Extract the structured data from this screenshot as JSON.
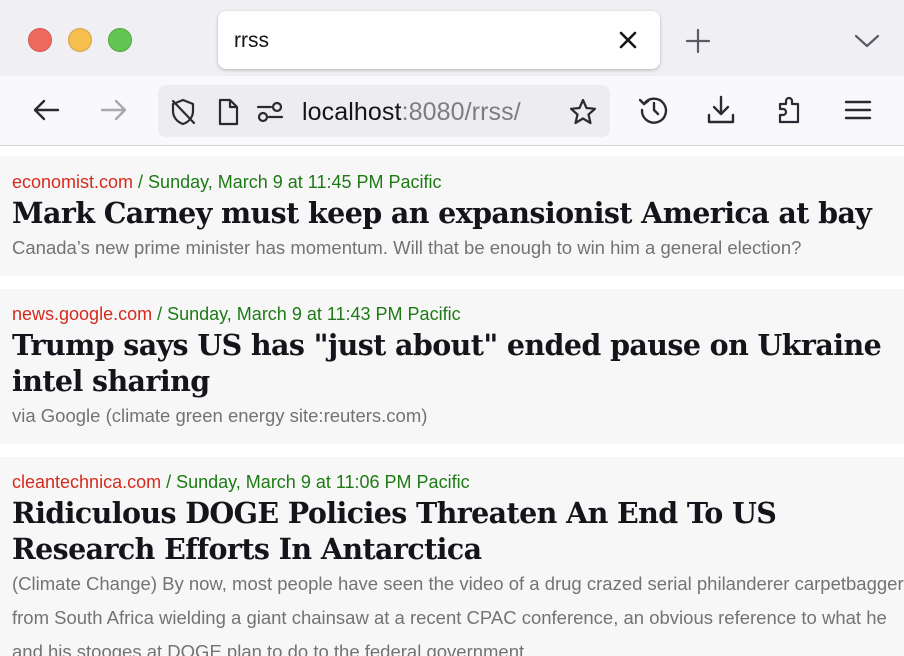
{
  "browser": {
    "tab": {
      "title": "rrss"
    },
    "url": {
      "host": "localhost",
      "rest": ":8080/rrss/"
    }
  },
  "articles": [
    {
      "source": "economist.com",
      "date": "/ Sunday, March 9 at 11:45 PM Pacific",
      "headline": "Mark Carney must keep an expansionist America at bay",
      "summary": "Canada’s new prime minister has momentum. Will that be enough to win him a general election?"
    },
    {
      "source": "news.google.com",
      "date": "/ Sunday, March 9 at 11:43 PM Pacific",
      "headline": "Trump says US has \"just about\" ended pause on Ukraine intel sharing",
      "summary": "via Google (climate green energy site:reuters.com)"
    },
    {
      "source": "cleantechnica.com",
      "date": "/ Sunday, March 9 at 11:06 PM Pacific",
      "headline": "Ridiculous DOGE Policies Threaten An End To US Research Efforts In Antarctica",
      "summary": "(Climate Change) By now, most people have seen the video of a drug crazed serial philanderer carpetbagger from South Africa wielding a giant chainsaw at a recent CPAC conference, an obvious reference to what he and his stooges at DOGE plan to do to the federal government."
    }
  ]
}
